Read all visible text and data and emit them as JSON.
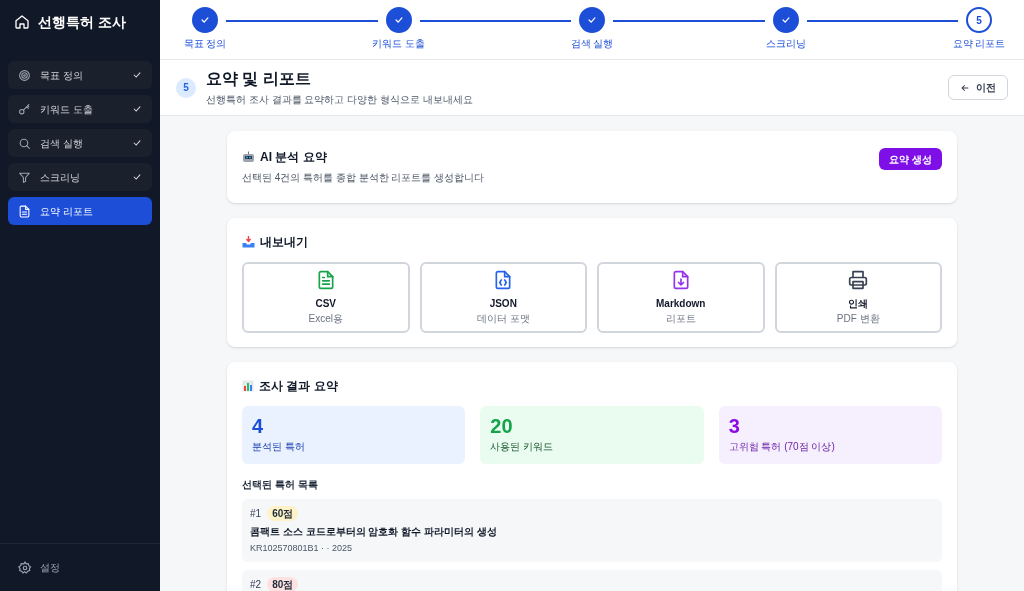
{
  "app_title": "선행특허 조사",
  "sidebar": {
    "items": [
      {
        "label": "목표 정의",
        "done": true,
        "selected": false
      },
      {
        "label": "키워드 도출",
        "done": true,
        "selected": false
      },
      {
        "label": "검색 실행",
        "done": true,
        "selected": false
      },
      {
        "label": "스크리닝",
        "done": true,
        "selected": false
      },
      {
        "label": "요약 리포트",
        "done": false,
        "selected": true
      }
    ],
    "settings": "설정"
  },
  "stepper": [
    {
      "label": "목표 정의",
      "done": true
    },
    {
      "label": "키워드 도출",
      "done": true
    },
    {
      "label": "검색 실행",
      "done": true
    },
    {
      "label": "스크리닝",
      "done": true
    },
    {
      "label": "요약 리포트",
      "number": "5",
      "done": false
    }
  ],
  "header": {
    "step": "5",
    "title": "요약 및 리포트",
    "subtitle": "선행특허 조사 결과를 요약하고 다양한 형식으로 내보내세요",
    "back": "이전"
  },
  "ai_summary": {
    "title": "AI 분석 요약",
    "description": "선택된 4건의 특허를 종합 분석한 리포트를 생성합니다",
    "button": "요약 생성"
  },
  "export": {
    "title": "내보내기",
    "options": [
      {
        "kind": "csv",
        "label": "CSV",
        "sub": "Excel용"
      },
      {
        "kind": "json",
        "label": "JSON",
        "sub": "데이터 포맷"
      },
      {
        "kind": "markdown",
        "label": "Markdown",
        "sub": "리포트"
      },
      {
        "kind": "print",
        "label": "인쇄",
        "sub": "PDF 변환"
      }
    ]
  },
  "results": {
    "title": "조사 결과 요약",
    "stats": [
      {
        "kind": "blue",
        "value": "4",
        "label": "분석된 특허"
      },
      {
        "kind": "green",
        "value": "20",
        "label": "사용된 키워드"
      },
      {
        "kind": "purple",
        "value": "3",
        "label": "고위험 특허 (70점 이상)"
      }
    ],
    "list_title": "선택된 특허 목록",
    "patents": [
      {
        "index": "#1",
        "score": "60점",
        "color": "#fef3c7",
        "title": "콤팩트 소스 코드로부터의 암호화 함수 파라미터의 생성",
        "meta": "KR102570801B1 · · 2025"
      },
      {
        "index": "#2",
        "score": "80점",
        "color": "#fee2e2"
      }
    ]
  }
}
